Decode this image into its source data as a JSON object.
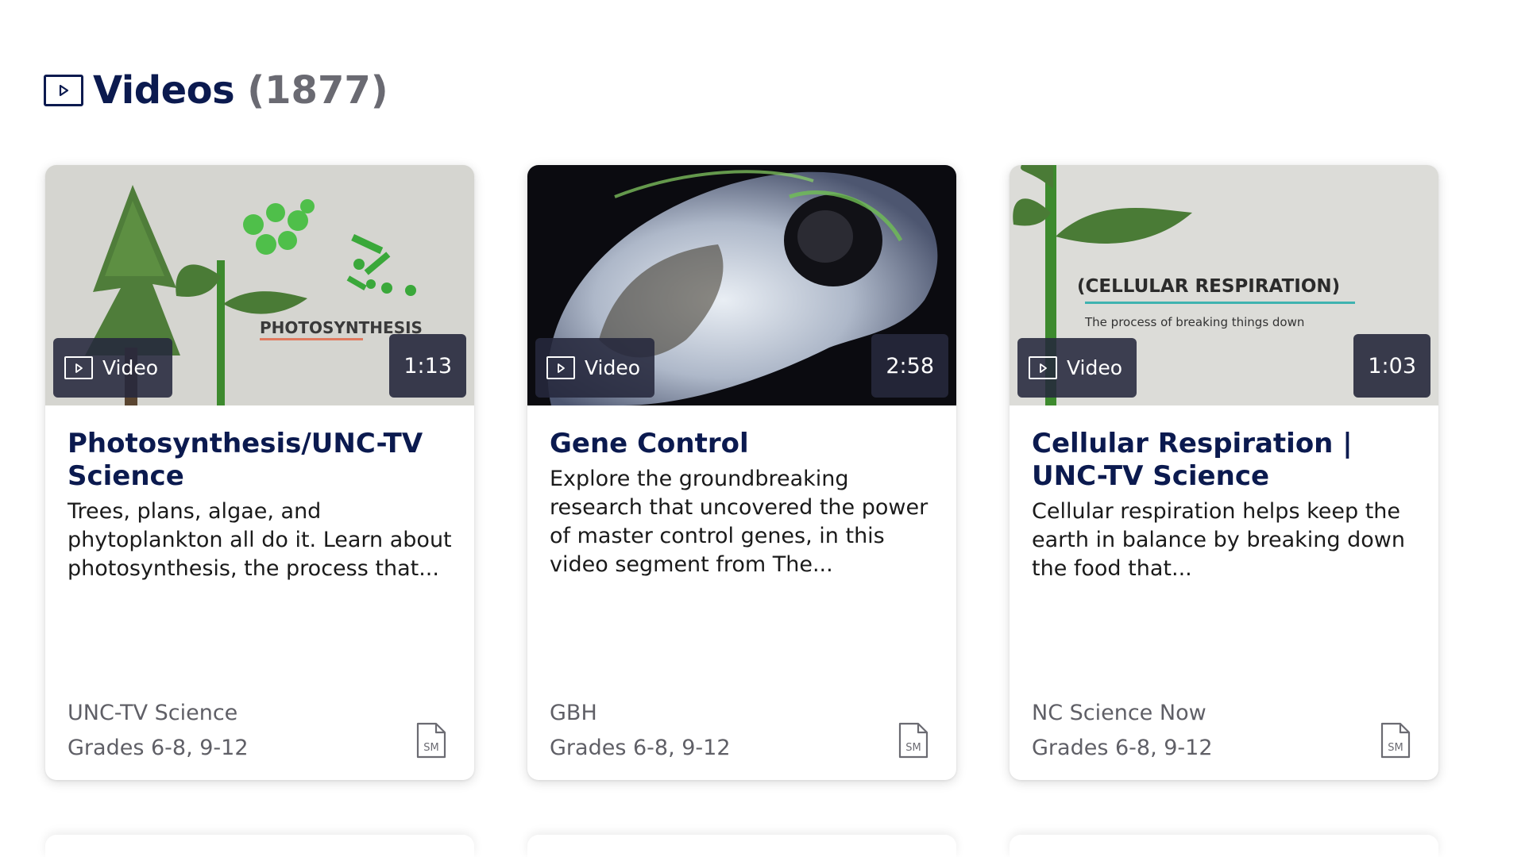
{
  "section": {
    "title": "Videos",
    "count": "(1877)",
    "icon": "video-play-icon"
  },
  "cards": [
    {
      "title": "Photosynthesis/UNC-TV Science",
      "description": "Trees, plans, algae, and phytoplankton all do it. Learn about photosynthesis, the process that...",
      "badge": "Video",
      "duration": "1:13",
      "thumbnail_text": "PHOTOSYNTHESIS",
      "source": "UNC-TV Science",
      "grades": "Grades 6-8, 9-12",
      "file_icon_label": "SM"
    },
    {
      "title": "Gene Control",
      "description": "Explore the groundbreaking research that uncovered the power of master control genes, in this video segment from The...",
      "badge": "Video",
      "duration": "2:58",
      "source": "GBH",
      "grades": "Grades 6-8, 9-12",
      "file_icon_label": "SM"
    },
    {
      "title": "Cellular Respiration | UNC-TV Science",
      "description": "Cellular respiration helps keep the earth in balance by breaking down the food that...",
      "badge": "Video",
      "duration": "1:03",
      "thumbnail_text": "(CELLULAR RESPIRATION)",
      "thumbnail_subtext": "The process of breaking things down",
      "source": "NC Science Now",
      "grades": "Grades 6-8, 9-12",
      "file_icon_label": "SM"
    }
  ],
  "colors": {
    "title_navy": "#0b1a4f",
    "count_gray": "#6a6a72",
    "meta_gray": "#5f5f66",
    "badge_bg": "#26283c"
  }
}
